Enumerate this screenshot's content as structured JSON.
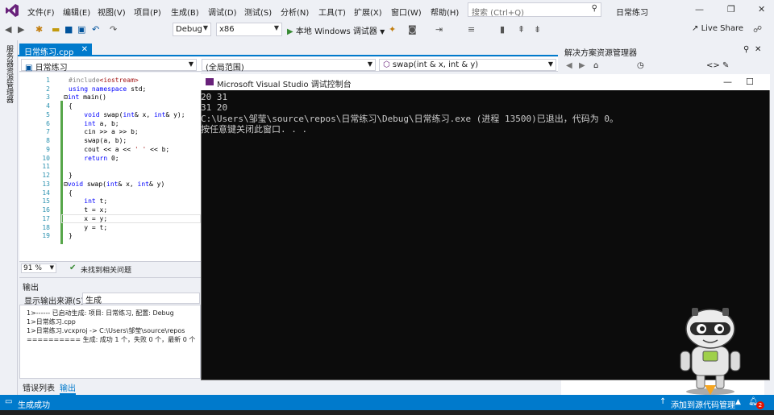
{
  "menu": {
    "items": [
      "文件(F)",
      "编辑(E)",
      "视图(V)",
      "项目(P)",
      "生成(B)",
      "调试(D)",
      "测试(S)",
      "分析(N)",
      "工具(T)",
      "扩展(X)",
      "窗口(W)",
      "帮助(H)"
    ],
    "search_placeholder": "搜索 (Ctrl+Q)",
    "solution_title": "日常练习"
  },
  "toolbar": {
    "config": "Debug",
    "platform": "x86",
    "run_label": "本地 Windows 调试器",
    "live_share": "Live Share"
  },
  "left_strip": {
    "label": "服务器资源管理器"
  },
  "editor": {
    "tab_label": "日常练习.cpp",
    "nav_project": "日常练习",
    "nav_scope": "(全局范围)",
    "nav_function": "swap(int & x, int & y)",
    "zoom": "91 %",
    "issues": "未找到相关问题",
    "line_numbers": [
      "1",
      "2",
      "3",
      "4",
      "5",
      "6",
      "7",
      "8",
      "9",
      "10",
      "11",
      "12",
      "13",
      "14",
      "15",
      "16",
      "17",
      "18",
      "19"
    ]
  },
  "output": {
    "title": "输出",
    "source_label": "显示输出来源(S):",
    "source_value": "生成",
    "lines": [
      "1>------ 已启动生成: 项目: 日常练习, 配置: Debug",
      "1>日常练习.cpp",
      "1>日常练习.vcxproj -> C:\\Users\\邹莹\\source\\repos",
      "========== 生成: 成功 1 个，失败 0 个，最新 0 个"
    ],
    "tab_errors": "错误列表",
    "tab_output": "输出"
  },
  "console": {
    "title": "Microsoft Visual Studio 调试控制台",
    "lines": [
      "20 31",
      "31 20",
      "C:\\Users\\邹莹\\source\\repos\\日常练习\\Debug\\日常练习.exe (进程 13500)已退出，代码为 0。",
      "按任意键关闭此窗口. . ."
    ]
  },
  "solution_explorer": {
    "title": "解决方案资源管理器"
  },
  "status": {
    "left": "生成成功",
    "right": "添加到源代码管理",
    "badge": "2"
  },
  "colors": {
    "accent": "#007acc",
    "console_bg": "#0c0c0c",
    "success": "#388a34"
  }
}
